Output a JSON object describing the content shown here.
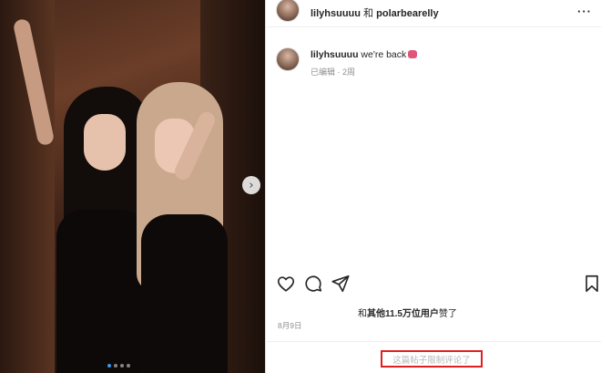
{
  "header": {
    "user1": "lilyhsuuuu",
    "conj": " 和 ",
    "user2": "polarbearelly",
    "more_icon": "more-horizontal-icon"
  },
  "caption": {
    "username": "lilyhsuuuu",
    "text": " we're back",
    "emoji": "heart-emoji",
    "meta": "已编辑 · 2周"
  },
  "actions": {
    "like_icon": "heart-icon",
    "comment_icon": "comment-icon",
    "share_icon": "send-icon",
    "save_icon": "bookmark-icon"
  },
  "likes": {
    "prefix": "和",
    "bold": "其他11.5万位用户",
    "suffix": "赞了"
  },
  "date": "8月9日",
  "comments_limited": "这篇帖子限制评论了",
  "carousel": {
    "slide_count": 4,
    "active_index": 0
  },
  "colors": {
    "dot_active": "#3897f0",
    "highlight_border": "#e02020"
  }
}
